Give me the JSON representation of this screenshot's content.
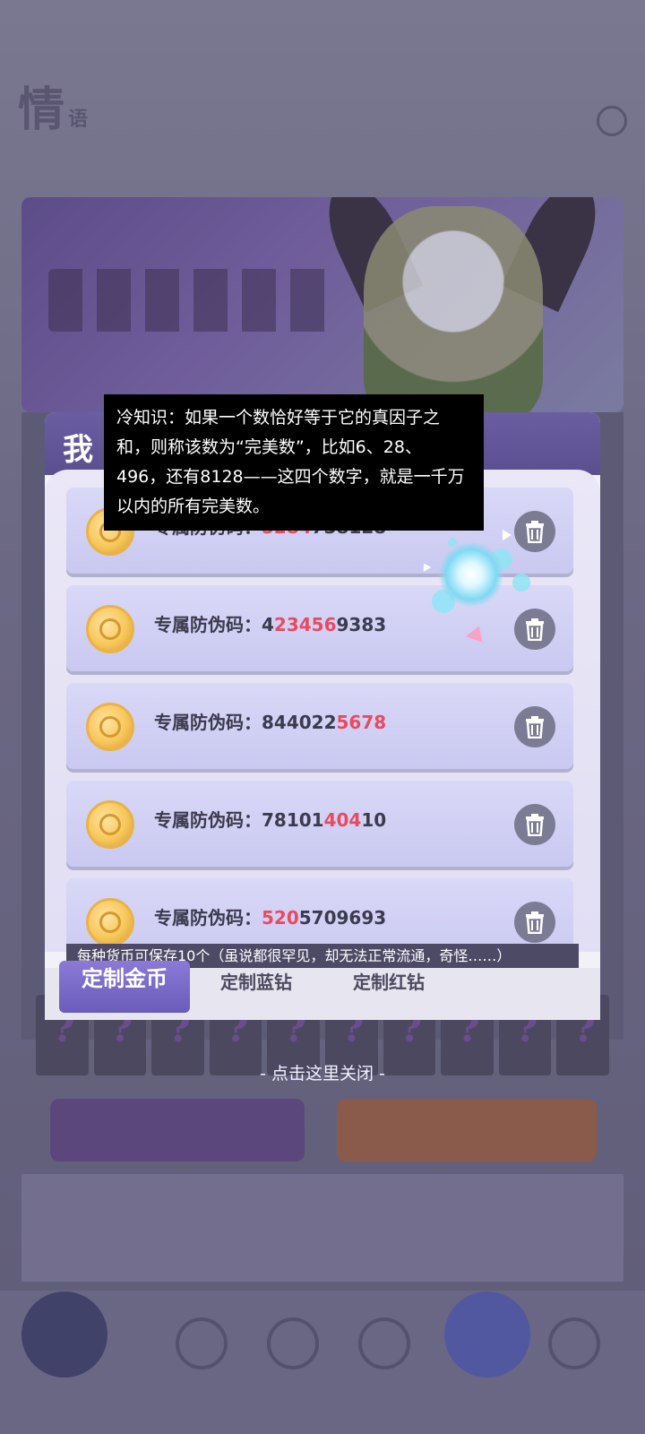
{
  "app": {
    "logo_text": "情",
    "logo_small": "语"
  },
  "modal": {
    "title": "我",
    "cards": [
      {
        "label": "专属防伪码：",
        "code_pre": "",
        "code_hl": "5284",
        "code_post": "738128",
        "hidden_partial": true
      },
      {
        "label": "专属防伪码：",
        "code_pre": "4",
        "code_hl": "23456",
        "code_post": "9383"
      },
      {
        "label": "专属防伪码：",
        "code_pre": "844022",
        "code_hl": "5678",
        "code_post": ""
      },
      {
        "label": "专属防伪码：",
        "code_pre": "78101",
        "code_hl": "404",
        "code_post": "10"
      },
      {
        "label": "专属防伪码：",
        "code_pre": "",
        "code_hl": "520",
        "code_post": "5709693"
      }
    ],
    "info_strip": "每种货币可保存10个（虽说都很罕见，却无法正常流通，奇怪……）",
    "tabs": [
      "定制金币",
      "定制蓝钻",
      "定制红钻"
    ]
  },
  "close_hint": "- 点击这里关闭 -",
  "tooltip": "冷知识：如果一个数恰好等于它的真因子之和，则称该数为“完美数”，比如6、28、496，还有8128——这四个数字，就是一千万以内的所有完美数。",
  "colors": {
    "highlight": "#e84a62",
    "tab_active": "#7a6bc8",
    "modal_header": "#5f5396"
  }
}
